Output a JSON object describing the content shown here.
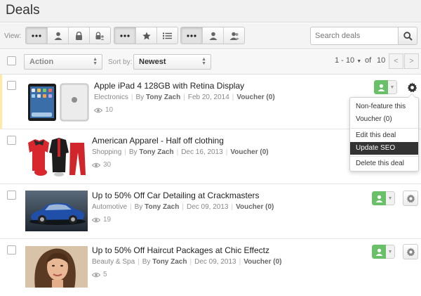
{
  "header": {
    "title": "Deals"
  },
  "toolbar": {
    "view_label": "View:",
    "group1": [
      {
        "icon": "more-dots-icon"
      },
      {
        "icon": "user-icon"
      },
      {
        "icon": "lock-icon"
      },
      {
        "icon": "lock-user-icon"
      }
    ],
    "group2": [
      {
        "icon": "more-dots-icon"
      },
      {
        "icon": "star-icon"
      },
      {
        "icon": "list-icon"
      }
    ],
    "group3": [
      {
        "icon": "more-dots-icon"
      },
      {
        "icon": "user-icon"
      },
      {
        "icon": "user-group-icon"
      }
    ],
    "search": {
      "placeholder": "Search deals",
      "value": ""
    }
  },
  "action_bar": {
    "action_select": "Action",
    "sort_label": "Sort by:",
    "sort_select": "Newest",
    "range": "1 - 10",
    "of": "of",
    "total": "10",
    "prev": "<",
    "next": ">"
  },
  "deals": [
    {
      "title": "Apple iPad 4 128GB with Retina Display",
      "category": "Electronics",
      "by": "By",
      "author": "Tony Zach",
      "date": "Feb 20, 2014",
      "voucher": "Voucher (0)",
      "views": "10",
      "featured": true,
      "thumb": "ipad"
    },
    {
      "title": "American Apparel - Half off clothing",
      "category": "Shopping",
      "by": "By",
      "author": "Tony Zach",
      "date": "Dec 16, 2013",
      "voucher": "Voucher (0)",
      "views": "30",
      "featured": false,
      "thumb": "clothing"
    },
    {
      "title": "Up to 50% Off Car Detailing at Crackmasters",
      "category": "Automotive",
      "by": "By",
      "author": "Tony Zach",
      "date": "Dec 09, 2013",
      "voucher": "Voucher (0)",
      "views": "19",
      "featured": false,
      "thumb": "car"
    },
    {
      "title": "Up to 50% Off Haircut Packages at Chic Effectz",
      "category": "Beauty & Spa",
      "by": "By",
      "author": "Tony Zach",
      "date": "Dec 09, 2013",
      "voucher": "Voucher (0)",
      "views": "5",
      "featured": false,
      "thumb": "portrait"
    }
  ],
  "dropdown": {
    "items": [
      "Non-feature this",
      "Voucher (0)",
      "Edit this deal",
      "Update SEO",
      "Delete this deal"
    ],
    "active": "Update SEO"
  },
  "colors": {
    "feature_green": "#6abf69",
    "highlight_border": "#ffe9a6",
    "menu_active": "#333333"
  }
}
